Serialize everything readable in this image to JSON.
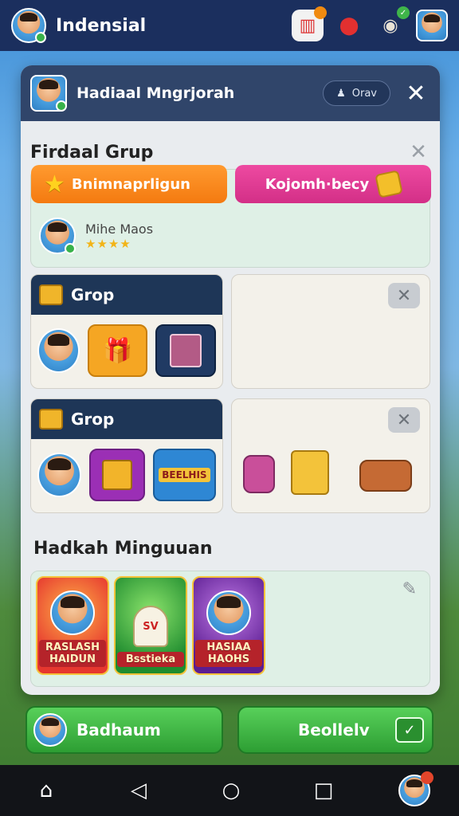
{
  "app": {
    "title": "Indensial"
  },
  "top_icons": [
    {
      "name": "shop-icon",
      "badge": ""
    },
    {
      "name": "chef-icon",
      "badge": ""
    },
    {
      "name": "bag-icon",
      "badge": ""
    }
  ],
  "dialog": {
    "title": "Hadiaal Mngrjorah",
    "pill_label": "Orav"
  },
  "grup": {
    "title": "Firdaal Grup",
    "tab_left": "Bnimnaprligun",
    "tab_right": "Kojomh·becy",
    "member_name": "Mihe Maos",
    "member_stars": "★★★★"
  },
  "groups": [
    {
      "title": "Grop"
    },
    {
      "title": "Grop",
      "item3_label": "BEELHIS"
    }
  ],
  "minguuan": {
    "title": "Hadkah Minguuan",
    "posters": [
      "RASLASH HAIDUN",
      "Bsstieka",
      "HASIAA HAOHS"
    ],
    "poster2_sign": "SV"
  },
  "buttons": {
    "left_label": "Badhaum",
    "right_label": "Beollelv"
  },
  "colors": {
    "accent_green": "#2d9e33",
    "header_navy": "#1b2f5e",
    "tab_orange": "#f47a10",
    "tab_pink": "#d32f87"
  }
}
